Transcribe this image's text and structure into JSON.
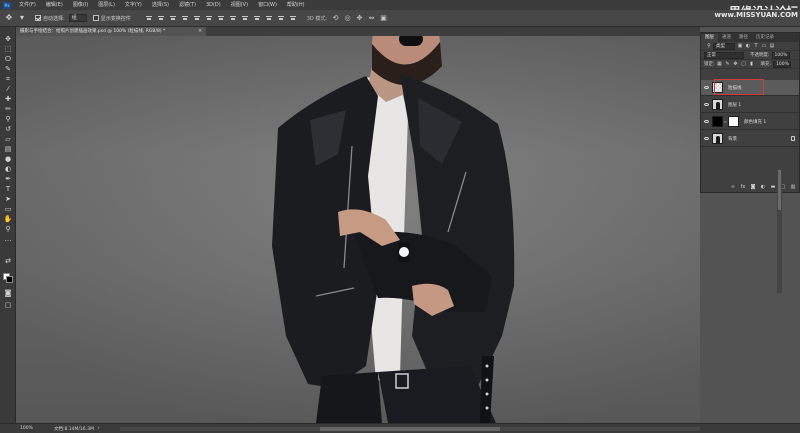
{
  "app": {
    "logo": "Ps"
  },
  "menu": [
    "文件(F)",
    "编辑(E)",
    "图像(I)",
    "图层(L)",
    "文字(Y)",
    "选择(S)",
    "滤镜(T)",
    "3D(D)",
    "视图(V)",
    "窗口(W)",
    "帮助(H)"
  ],
  "watermark": {
    "text": "思缘设计论坛",
    "url": "www.MISSYUAN.COM"
  },
  "options": {
    "auto_select_label": "自动选择:",
    "auto_select_value": "组",
    "show_transform_label": "显示变换控件",
    "mode_3d_label": "3D 模式:"
  },
  "document": {
    "tab_title": "摄影与手绘结合：给照片创建插画效果.psd @ 100% (粒描线, RGB/8) *",
    "close_glyph": "×"
  },
  "layers_panel": {
    "tabs": [
      "图层",
      "通道",
      "路径",
      "历史记录"
    ],
    "filter_kind": "类型",
    "blend_mode": "正常",
    "opacity_label": "不透明度:",
    "opacity_value": "100%",
    "lock_label": "锁定:",
    "fill_label": "填充:",
    "fill_value": "100%",
    "layers": [
      {
        "name": "粒描线",
        "thumb": "checker",
        "selected": true
      },
      {
        "name": "图层 1",
        "thumb": "person",
        "selected": false
      },
      {
        "name": "颜色填充 1",
        "thumb": "black",
        "mask": "white",
        "selected": false
      },
      {
        "name": "背景",
        "thumb": "person",
        "locked": true,
        "selected": false
      }
    ],
    "footer_icons": [
      "link-icon",
      "fx-icon",
      "mask-icon",
      "adjustment-icon",
      "folder-icon",
      "new-layer-icon",
      "trash-icon"
    ]
  },
  "status": {
    "zoom": "100%",
    "doc_size": "文档:8.14M/16.3M",
    "arrow": "›"
  },
  "colors": {
    "menubar_bg": "#3b3b3b",
    "panel_bg": "#3f3f3f",
    "selection_highlight": "#d23b3b"
  }
}
